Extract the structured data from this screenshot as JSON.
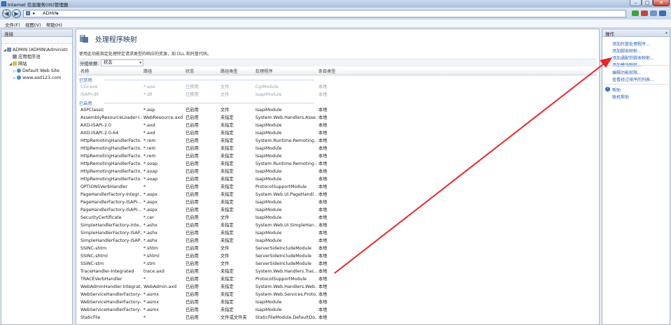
{
  "window": {
    "title": "Internet 信息服务(IIS)管理器",
    "min": "–",
    "max": "□",
    "close": "✕"
  },
  "address": {
    "path": "ADMIN",
    "sep": "▸",
    "arrow": "▸"
  },
  "nav": {
    "back": "◀",
    "forward": "▶"
  },
  "menu": [
    "文件(F)",
    "视图(V)",
    "帮助(H)"
  ],
  "connections": {
    "header": "连接",
    "tree": [
      {
        "label": "ADMIN (ADMIN\\Administr",
        "icon": "server-icon",
        "twisty": "◢"
      },
      {
        "label": "应用程序池",
        "icon": "app-pool-icon",
        "twisty": ""
      },
      {
        "label": "网站",
        "icon": "folder-icon",
        "twisty": "◢"
      },
      {
        "label": "Default Web Site",
        "icon": "globe-icon",
        "twisty": "▷"
      },
      {
        "label": "www.asd123.com",
        "icon": "globe-icon",
        "twisty": "▷"
      }
    ]
  },
  "feature": {
    "title": "处理程序映射",
    "description": "使用此功能指定处理特定请求类型的响应的资源，如 DLL 和托管代码。",
    "group_label": "分组依据:",
    "group_value": "状态",
    "group_arrow": "▾"
  },
  "columns": [
    "名称",
    "路径",
    "状态",
    "路径类型",
    "处理程序",
    "条目类型"
  ],
  "groups": [
    {
      "name": "已禁用",
      "disabled": true,
      "rows": [
        [
          "CGI-exe",
          "*.exe",
          "已禁用",
          "文件",
          "CgiModule",
          "本地"
        ],
        [
          "ISAPI-dll",
          "*.dll",
          "已禁用",
          "文件",
          "IsapiModule",
          "本地"
        ]
      ]
    },
    {
      "name": "已启用",
      "disabled": false,
      "rows": [
        [
          "ASPClassic",
          "*.asp",
          "已启用",
          "文件",
          "IsapiModule",
          "本地"
        ],
        [
          "AssemblyResourceLoader-I...",
          "WebResource.axd",
          "已启用",
          "未指定",
          "System.Web.Handlers.Asse...",
          "本地"
        ],
        [
          "AXD-ISAPI-2.0",
          "*.axd",
          "已启用",
          "未指定",
          "IsapiModule",
          "本地"
        ],
        [
          "AXD-ISAPI-2.0-64",
          "*.axd",
          "已启用",
          "未指定",
          "IsapiModule",
          "本地"
        ],
        [
          "HttpRemotingHandlerFacto...",
          "*.rem",
          "已启用",
          "未指定",
          "System.Runtime.Remoting....",
          "本地"
        ],
        [
          "HttpRemotingHandlerFacto...",
          "*.rem",
          "已启用",
          "未指定",
          "IsapiModule",
          "本地"
        ],
        [
          "HttpRemotingHandlerFacto...",
          "*.rem",
          "已启用",
          "未指定",
          "IsapiModule",
          "本地"
        ],
        [
          "HttpRemotingHandlerFacto...",
          "*.soap",
          "已启用",
          "未指定",
          "System.Runtime.Remoting....",
          "本地"
        ],
        [
          "HttpRemotingHandlerFacto...",
          "*.soap",
          "已启用",
          "未指定",
          "IsapiModule",
          "本地"
        ],
        [
          "HttpRemotingHandlerFacto...",
          "*.soap",
          "已启用",
          "未指定",
          "IsapiModule",
          "本地"
        ],
        [
          "OPTIONSVerbHandler",
          "*",
          "已启用",
          "未指定",
          "ProtocolSupportModule",
          "本地"
        ],
        [
          "PageHandlerFactory-Integr...",
          "*.aspx",
          "已启用",
          "未指定",
          "System.Web.UI.PageHandl...",
          "本地"
        ],
        [
          "PageHandlerFactory-ISAPI-...",
          "*.aspx",
          "已启用",
          "未指定",
          "IsapiModule",
          "本地"
        ],
        [
          "PageHandlerFactory-ISAPI-...",
          "*.aspx",
          "已启用",
          "未指定",
          "IsapiModule",
          "本地"
        ],
        [
          "SecurityCertificate",
          "*.cer",
          "已启用",
          "文件",
          "IsapiModule",
          "本地"
        ],
        [
          "SimpleHandlerFactory-Inte...",
          "*.ashx",
          "已启用",
          "未指定",
          "System.Web.UI.SimpleHan...",
          "本地"
        ],
        [
          "SimpleHandlerFactory-ISAP...",
          "*.ashx",
          "已启用",
          "未指定",
          "IsapiModule",
          "本地"
        ],
        [
          "SimpleHandlerFactory-ISAP...",
          "*.ashx",
          "已启用",
          "未指定",
          "IsapiModule",
          "本地"
        ],
        [
          "SSINC-shtm",
          "*.shtm",
          "已启用",
          "文件",
          "ServerSideIncludeModule",
          "本地"
        ],
        [
          "SSINC-shtml",
          "*.shtml",
          "已启用",
          "文件",
          "ServerSideIncludeModule",
          "本地"
        ],
        [
          "SSINC-stm",
          "*.stm",
          "已启用",
          "文件",
          "ServerSideIncludeModule",
          "本地"
        ],
        [
          "TraceHandler-Integrated",
          "trace.axd",
          "已启用",
          "未指定",
          "System.Web.Handlers.Trac...",
          "本地"
        ],
        [
          "TRACEVerbHandler",
          "*",
          "已启用",
          "未指定",
          "ProtocolSupportModule",
          "本地"
        ],
        [
          "WebAdminHandler-Integrat...",
          "WebAdmin.axd",
          "已启用",
          "未指定",
          "System.Web.Handlers.Web...",
          "本地"
        ],
        [
          "WebServiceHandlerFactory-...",
          "*.asmx",
          "已启用",
          "未指定",
          "System.Web.Services.Proto...",
          "本地"
        ],
        [
          "WebServiceHandlerFactory-...",
          "*.asmx",
          "已启用",
          "未指定",
          "IsapiModule",
          "本地"
        ],
        [
          "WebServiceHandlerFactory-...",
          "*.asmx",
          "已启用",
          "未指定",
          "IsapiModule",
          "本地"
        ],
        [
          "StaticFile",
          "*",
          "已启用",
          "文件或文件夹",
          "StaticFileModule,DefaultDo...",
          "本地"
        ]
      ]
    }
  ],
  "actions": {
    "header": "操作",
    "collapse": "▴",
    "items": [
      "添加托管处理程序...",
      "添加脚本映射...",
      "添加通配符脚本映射...",
      "添加模块映射...",
      "编辑功能权限...",
      "查看经过排序的列表..."
    ],
    "help_items": [
      "帮助",
      "联机帮助"
    ],
    "help_glyph": "?"
  },
  "annotation": {
    "arrow_color": "#e8262b"
  }
}
